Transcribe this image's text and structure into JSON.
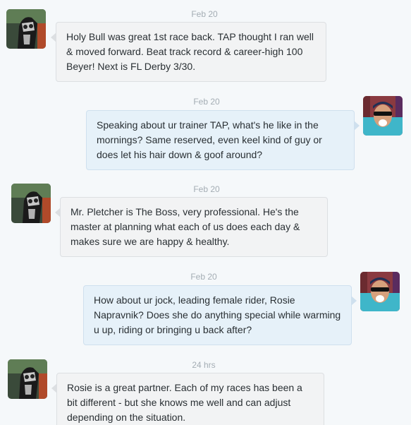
{
  "conversation": {
    "messages": [
      {
        "timestamp": "Feb 20",
        "direction": "incoming",
        "avatar_icon": "racehorse-avatar-icon",
        "text": "Holy Bull was great 1st race back. TAP thought I ran well & moved forward. Beat track record & career-high 100 Beyer! Next is FL Derby 3/30."
      },
      {
        "timestamp": "Feb 20",
        "direction": "outgoing",
        "avatar_icon": "user-avatar-icon",
        "text": "Speaking about ur trainer TAP, what's he like in the mornings? Same reserved, even keel kind of guy or does let his hair down & goof around?"
      },
      {
        "timestamp": "Feb 20",
        "direction": "incoming",
        "avatar_icon": "racehorse-avatar-icon",
        "text": "Mr. Pletcher is The Boss, very professional. He's the master at planning what each of us does each day & makes sure we are happy & healthy."
      },
      {
        "timestamp": "Feb 20",
        "direction": "outgoing",
        "avatar_icon": "user-avatar-icon",
        "text": "How about ur jock, leading female rider, Rosie Napravnik? Does she do anything special while warming u up, riding or bringing u back after?"
      },
      {
        "timestamp": "24 hrs",
        "direction": "incoming",
        "avatar_icon": "racehorse-avatar-icon",
        "text": "Rosie is a great partner. Each of my races has been a bit different - but she knows me well and can adjust depending on the situation."
      }
    ]
  },
  "colors": {
    "background": "#f5f8fa",
    "incoming_bubble": "#f2f3f4",
    "outgoing_bubble": "#e6f1f9",
    "timestamp_text": "#a4adb4",
    "message_text": "#292f33"
  }
}
